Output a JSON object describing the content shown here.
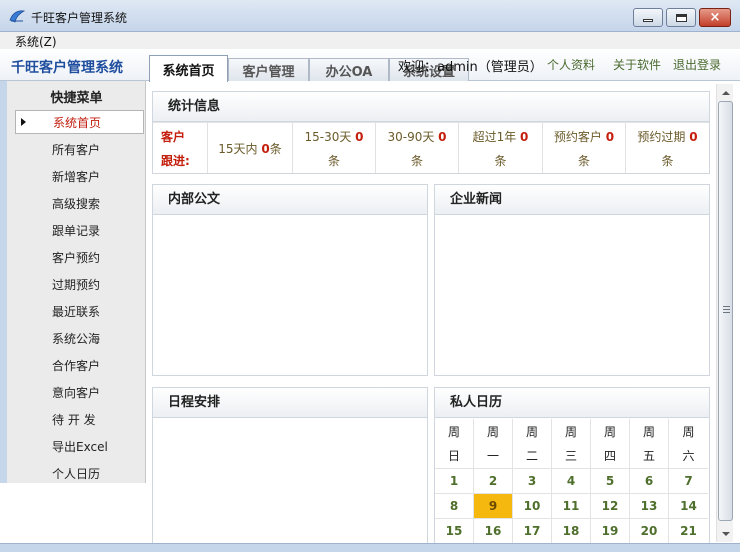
{
  "window": {
    "title": "千旺客户管理系统",
    "icon": "app-icon",
    "controls": {
      "minimize": "minimize-icon",
      "maximize": "maximize-icon",
      "close": "×"
    }
  },
  "menubar": {
    "items": [
      {
        "label": "系统(Z)"
      }
    ]
  },
  "header": {
    "app_title": "千旺客户管理系统",
    "tabs": [
      {
        "label": "系统首页",
        "active": true
      },
      {
        "label": "客户管理",
        "active": false
      },
      {
        "label": "办公OA",
        "active": false
      },
      {
        "label": "系统设置",
        "active": false
      }
    ],
    "welcome": "欢迎：admin（管理员）",
    "links": [
      {
        "label": "个人资料"
      },
      {
        "label": "关于软件"
      },
      {
        "label": "退出登录"
      }
    ]
  },
  "sidebar": {
    "title": "快捷菜单",
    "items": [
      {
        "label": "系统首页",
        "active": true
      },
      {
        "label": "所有客户"
      },
      {
        "label": "新增客户"
      },
      {
        "label": "高级搜索"
      },
      {
        "label": "跟单记录"
      },
      {
        "label": "客户预约"
      },
      {
        "label": "过期预约"
      },
      {
        "label": "最近联系"
      },
      {
        "label": "系统公海"
      },
      {
        "label": "合作客户"
      },
      {
        "label": "意向客户"
      },
      {
        "label": "待 开 发"
      },
      {
        "label": "导出Excel"
      },
      {
        "label": "个人日历"
      }
    ]
  },
  "stats": {
    "title": "统计信息",
    "label_line1": "客户",
    "label_line2": "跟进:",
    "cells": [
      {
        "top_prefix": "15天内",
        "num": "0",
        "top_suffix": "条",
        "bottom": ""
      },
      {
        "top_prefix": "15-30天",
        "num": "0",
        "top_suffix": "",
        "bottom": "条"
      },
      {
        "top_prefix": "30-90天",
        "num": "0",
        "top_suffix": "",
        "bottom": "条"
      },
      {
        "top_prefix": "超过1年",
        "num": "0",
        "top_suffix": "",
        "bottom": "条"
      },
      {
        "top_prefix": "预约客户",
        "num": "0",
        "top_suffix": "",
        "bottom": "条"
      },
      {
        "top_prefix": "预约过期",
        "num": "0",
        "top_suffix": "",
        "bottom": "条"
      }
    ]
  },
  "panels": {
    "internal_docs": {
      "title": "内部公文"
    },
    "company_news": {
      "title": "企业新闻"
    },
    "schedule": {
      "title": "日程安排"
    },
    "calendar": {
      "title": "私人日历",
      "weekday_line1": "周",
      "weekdays": [
        "日",
        "一",
        "二",
        "三",
        "四",
        "五",
        "六"
      ],
      "weeks": [
        [
          "1",
          "2",
          "3",
          "4",
          "5",
          "6",
          "7"
        ],
        [
          "8",
          "9",
          "10",
          "11",
          "12",
          "13",
          "14"
        ],
        [
          "15",
          "16",
          "17",
          "18",
          "19",
          "20",
          "21"
        ]
      ],
      "today": "9",
      "today_color": "#f4b80e"
    }
  },
  "colors": {
    "accent_title": "#1f4e9e",
    "stat_red": "#c41e0c",
    "calendar_green": "#4f6f2c",
    "link_green": "#4a6a2f"
  }
}
